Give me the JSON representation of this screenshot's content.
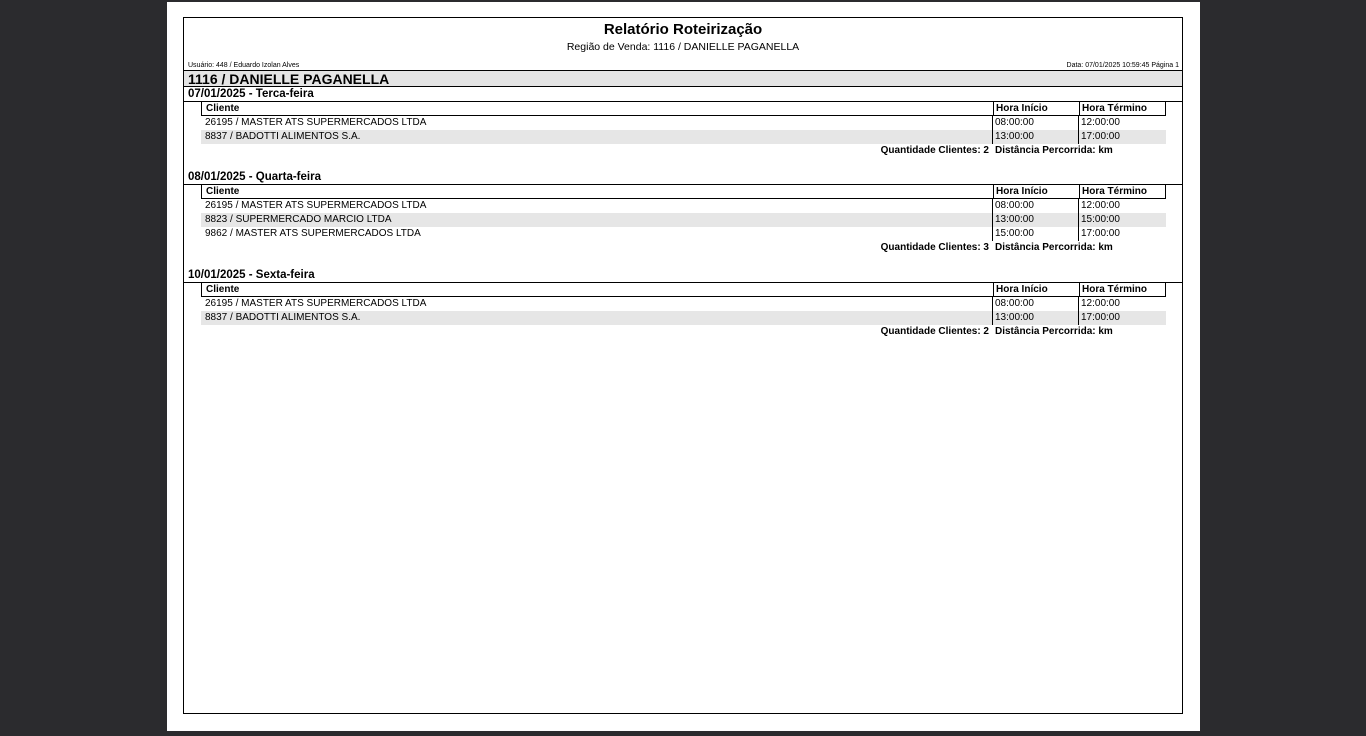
{
  "report": {
    "title": "Relatório Roteirização",
    "subtitle": "Região de Venda: 1116 / DANIELLE PAGANELLA",
    "user": "Usuário: 448 / Eduardo Izolan Alves",
    "date_page": "Data: 07/01/2025 10:59:45 Página 1",
    "region": "1116 / DANIELLE PAGANELLA"
  },
  "columns": {
    "client": "Cliente",
    "start": "Hora Início",
    "end": "Hora Término"
  },
  "days": [
    {
      "title": "07/01/2025 - Terca-feira",
      "rows": [
        {
          "client": "26195 / MASTER ATS SUPERMERCADOS LTDA",
          "start": "08:00:00",
          "end": "12:00:00"
        },
        {
          "client": "8837 / BADOTTI ALIMENTOS S.A.",
          "start": "13:00:00",
          "end": "17:00:00"
        }
      ],
      "qty": "Quantidade Clientes: 2",
      "distance": "Distância Percorrida:  km"
    },
    {
      "title": "08/01/2025 - Quarta-feira",
      "rows": [
        {
          "client": "26195 / MASTER ATS SUPERMERCADOS LTDA",
          "start": "08:00:00",
          "end": "12:00:00"
        },
        {
          "client": "8823 / SUPERMERCADO MARCIO LTDA",
          "start": "13:00:00",
          "end": "15:00:00"
        },
        {
          "client": "9862 / MASTER ATS SUPERMERCADOS LTDA",
          "start": "15:00:00",
          "end": "17:00:00"
        }
      ],
      "qty": "Quantidade Clientes: 3",
      "distance": "Distância Percorrida:  km"
    },
    {
      "title": "10/01/2025 - Sexta-feira",
      "rows": [
        {
          "client": "26195 / MASTER ATS SUPERMERCADOS LTDA",
          "start": "08:00:00",
          "end": "12:00:00"
        },
        {
          "client": "8837 / BADOTTI ALIMENTOS S.A.",
          "start": "13:00:00",
          "end": "17:00:00"
        }
      ],
      "qty": "Quantidade Clientes: 2",
      "distance": "Distância Percorrida:  km"
    }
  ]
}
